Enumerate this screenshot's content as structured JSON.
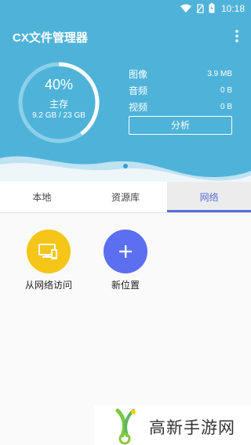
{
  "status": {
    "time": "10:18"
  },
  "app": {
    "title": "CX文件管理器"
  },
  "storage": {
    "percent_text": "40%",
    "percent_value": 0.4,
    "label": "主存",
    "size": "9.2 GB / 23 GB"
  },
  "stats": [
    {
      "label": "图像",
      "value": "3.9 MB"
    },
    {
      "label": "音频",
      "value": "0 B"
    },
    {
      "label": "视频",
      "value": "0 B"
    }
  ],
  "analyze_label": "分析",
  "tabs": [
    {
      "label": "本地"
    },
    {
      "label": "资源库"
    },
    {
      "label": "网络"
    }
  ],
  "network_items": [
    {
      "label": "从网络访问",
      "icon": "remote-access-icon",
      "color": "#f5c518"
    },
    {
      "label": "新位置",
      "icon": "plus-icon",
      "color": "#5b6ff0"
    }
  ],
  "watermark": {
    "text": "高新手游网"
  },
  "colors": {
    "header": "#4fb3d9",
    "accent": "#5a6fd8"
  }
}
